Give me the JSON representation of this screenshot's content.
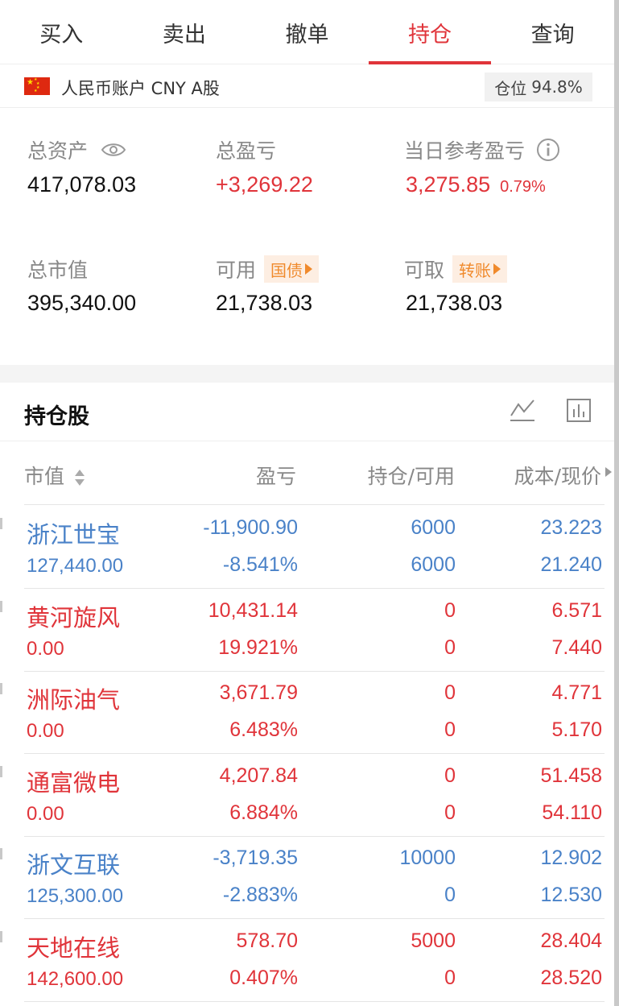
{
  "tabs": [
    {
      "label": "买入",
      "active": false
    },
    {
      "label": "卖出",
      "active": false
    },
    {
      "label": "撤单",
      "active": false
    },
    {
      "label": "持仓",
      "active": true
    },
    {
      "label": "查询",
      "active": false
    }
  ],
  "account": {
    "label": "人民币账户 CNY A股",
    "position_label": "仓位",
    "position_value": "94.8%"
  },
  "summary": {
    "total_assets_label": "总资产",
    "total_assets": "417,078.03",
    "total_pnl_label": "总盈亏",
    "total_pnl": "+3,269.22",
    "daily_pnl_label": "当日参考盈亏",
    "daily_pnl": "3,275.85",
    "daily_pnl_pct": "0.79%",
    "market_value_label": "总市值",
    "market_value": "395,340.00",
    "available_label": "可用",
    "available_tag": "国债",
    "available": "21,738.03",
    "withdrawable_label": "可取",
    "withdrawable_tag": "转账",
    "withdrawable": "21,738.03"
  },
  "holdings": {
    "title": "持仓股",
    "columns": {
      "market_value": "市值",
      "pnl": "盈亏",
      "position": "持仓/可用",
      "cost_price": "成本/现价"
    },
    "rows": [
      {
        "name": "浙江世宝",
        "market_value": "127,440.00",
        "pnl": "-11,900.90",
        "pnl_pct": "-8.541%",
        "position": "6000",
        "available": "6000",
        "cost": "23.223",
        "price": "21.240",
        "tone": "blue"
      },
      {
        "name": "黄河旋风",
        "market_value": "0.00",
        "pnl": "10,431.14",
        "pnl_pct": "19.921%",
        "position": "0",
        "available": "0",
        "cost": "6.571",
        "price": "7.440",
        "tone": "red"
      },
      {
        "name": "洲际油气",
        "market_value": "0.00",
        "pnl": "3,671.79",
        "pnl_pct": "6.483%",
        "position": "0",
        "available": "0",
        "cost": "4.771",
        "price": "5.170",
        "tone": "red"
      },
      {
        "name": "通富微电",
        "market_value": "0.00",
        "pnl": "4,207.84",
        "pnl_pct": "6.884%",
        "position": "0",
        "available": "0",
        "cost": "51.458",
        "price": "54.110",
        "tone": "red"
      },
      {
        "name": "浙文互联",
        "market_value": "125,300.00",
        "pnl": "-3,719.35",
        "pnl_pct": "-2.883%",
        "position": "10000",
        "available": "0",
        "cost": "12.902",
        "price": "12.530",
        "tone": "blue"
      },
      {
        "name": "天地在线",
        "market_value": "142,600.00",
        "pnl": "578.70",
        "pnl_pct": "0.407%",
        "position": "5000",
        "available": "0",
        "cost": "28.404",
        "price": "28.520",
        "tone": "red"
      }
    ]
  },
  "icons": [
    "flag-cn-icon",
    "eye-icon",
    "info-icon",
    "chevron-right-icon",
    "line-chart-icon",
    "bar-chart-icon",
    "sort-icon"
  ],
  "colors": {
    "up": "#e0343a",
    "down": "#4a82c8",
    "tag_text": "#f08a2c",
    "tag_bg": "#fdeee2"
  }
}
